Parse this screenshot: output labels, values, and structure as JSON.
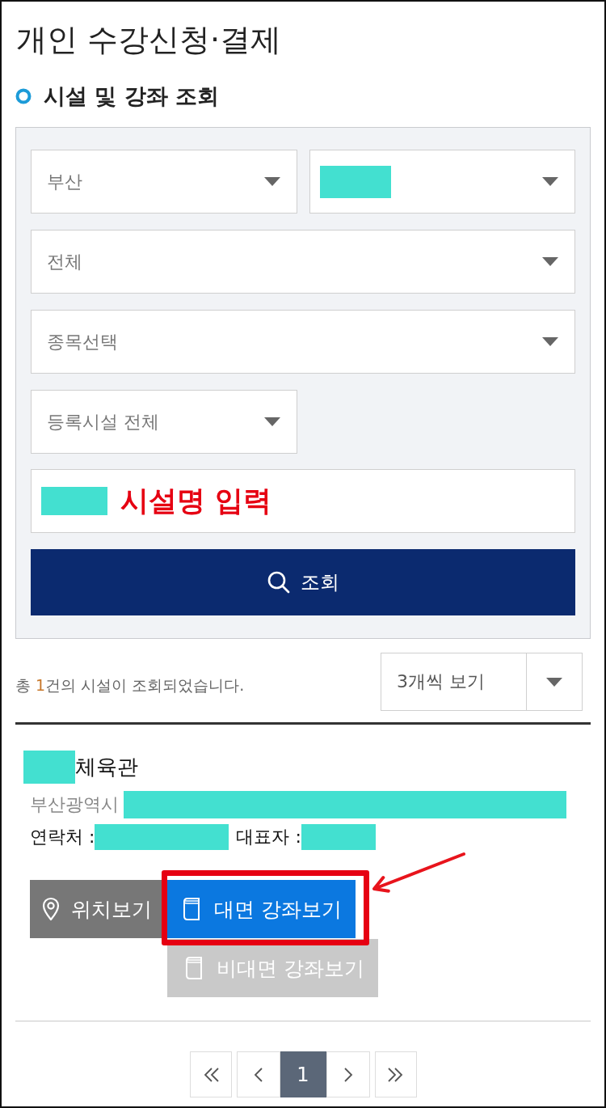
{
  "page": {
    "title": "개인 수강신청·결제"
  },
  "section": {
    "heading": "시설 및 강좌 조회"
  },
  "filters": [
    {
      "kind": "half",
      "value": "부산",
      "redacted": false
    },
    {
      "kind": "half",
      "redacted": true
    },
    {
      "kind": "full",
      "value": "전체",
      "redacted": false
    },
    {
      "kind": "full",
      "value": "종목선택",
      "redacted": false
    },
    {
      "kind": "half",
      "value": "등록시설 전체",
      "redacted": false
    }
  ],
  "name_field": {
    "value": "시설명 입력",
    "redacted": true
  },
  "search_button": {
    "label": "조회"
  },
  "results": {
    "count_prefix": "총 ",
    "count": "1",
    "count_suffix": "건의 시설이 조회되었습니다.",
    "per_page": "3개씩 보기"
  },
  "facility": {
    "name": "체육관",
    "name_redacted": true,
    "address": "부산광역시",
    "address_redacted": true,
    "contact_label": "연락처 :",
    "contact_redacted": true,
    "representative_label": "대표자 :",
    "representative_redacted": true,
    "buttons": [
      {
        "kind": "location",
        "label": "위치보기",
        "disabled": false,
        "highlighted": false
      },
      {
        "kind": "lecture",
        "label": "대면 강좌보기",
        "disabled": false,
        "highlighted": true
      },
      {
        "kind": "lecture",
        "label": "비대면 강좌보기",
        "disabled": true,
        "highlighted": false
      }
    ]
  },
  "pagination": {
    "pages": [
      {
        "kind": "first",
        "selected": false
      },
      {
        "kind": "prev",
        "selected": false
      },
      {
        "kind": "page",
        "label": "1",
        "selected": true
      },
      {
        "kind": "next",
        "selected": false
      },
      {
        "kind": "last",
        "selected": false
      }
    ]
  }
}
